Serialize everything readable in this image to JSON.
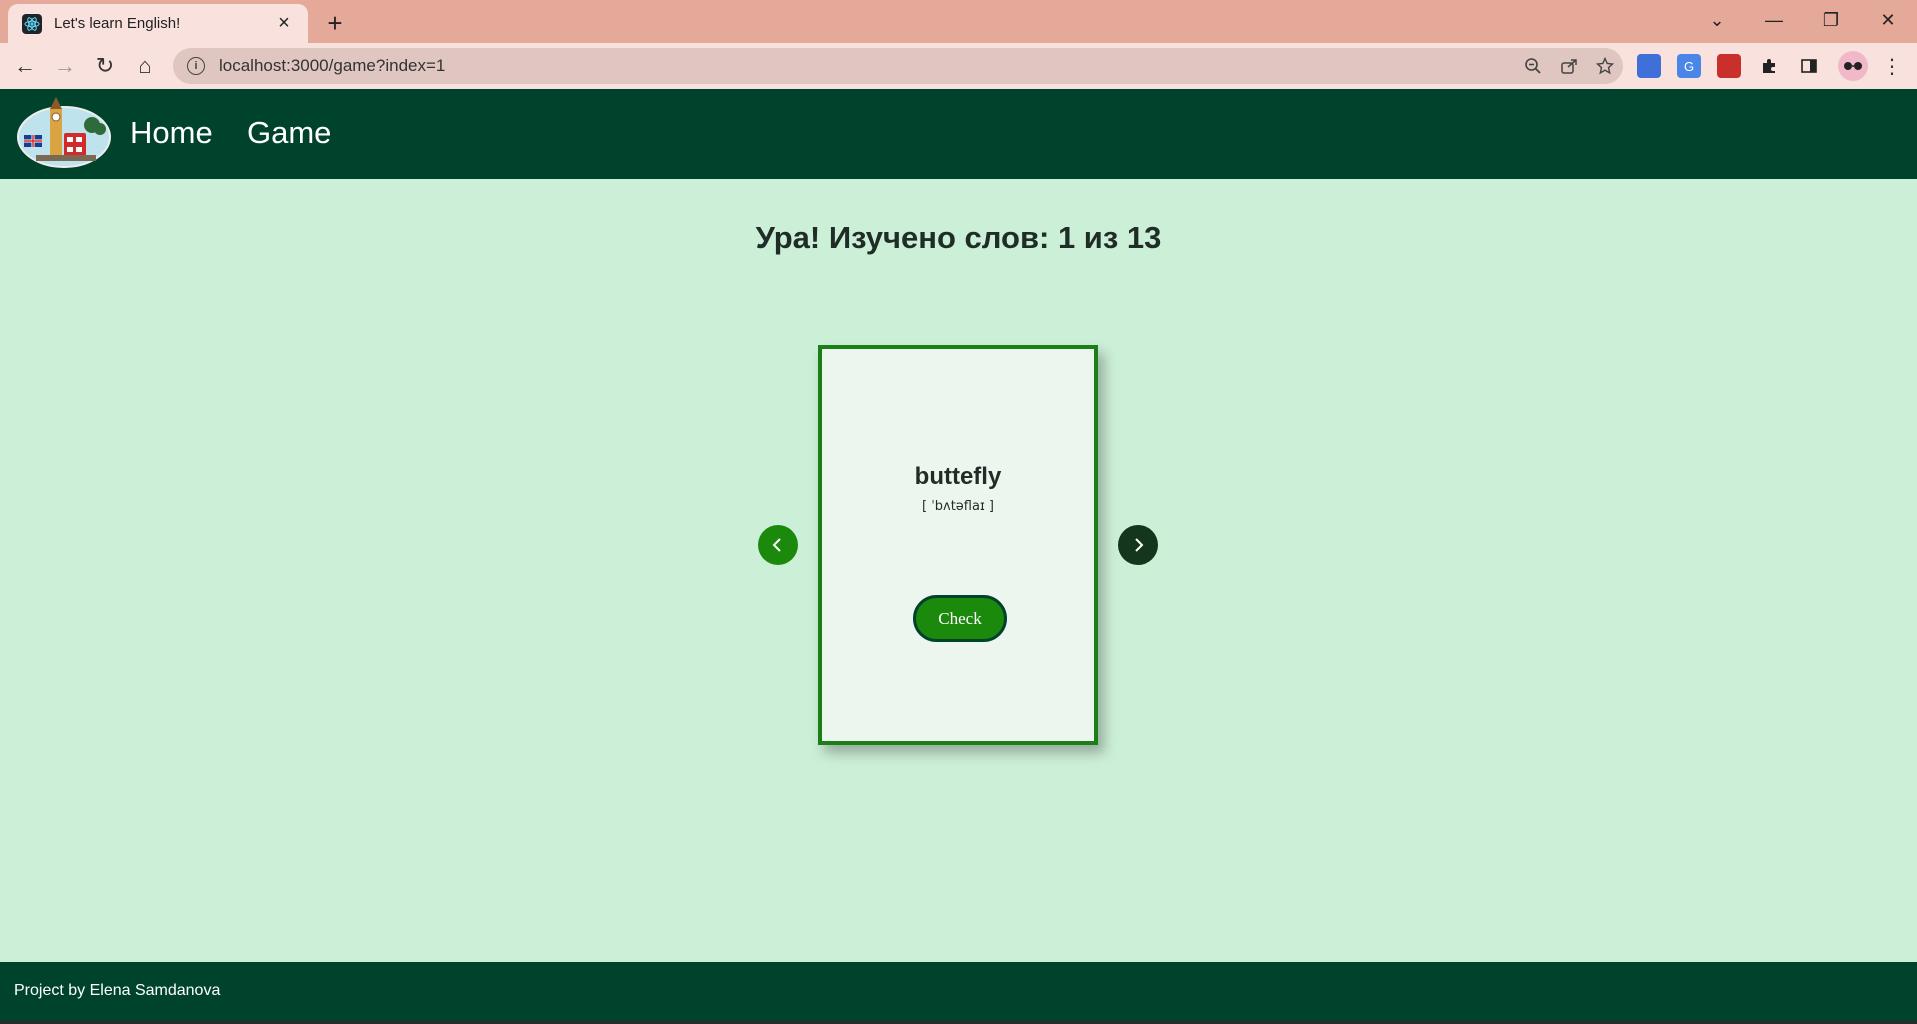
{
  "browser": {
    "tab_title": "Let's learn English!",
    "tab_close": "×",
    "new_tab": "+",
    "url": "localhost:3000/game?index=1",
    "window_controls": {
      "dropdown": "⌄",
      "minimize": "—",
      "restore": "❐",
      "close": "✕"
    },
    "nav": {
      "back": "←",
      "forward": "→",
      "reload": "↻",
      "home": "⌂"
    },
    "omnibox_icons": [
      "zoom-out-icon",
      "share-icon",
      "star-icon"
    ],
    "menu": "⋮"
  },
  "header": {
    "nav_items": [
      {
        "label": "Home"
      },
      {
        "label": "Game"
      }
    ]
  },
  "main": {
    "heading": "Ура! Изучено слов: 1 из 13",
    "prev_label": "‹",
    "next_label": "›",
    "card": {
      "word": "buttefly",
      "transcription": "[ ˈbʌtəflaɪ ]",
      "check_label": "Check"
    }
  },
  "footer": {
    "text": "Project by Elena Samdanova"
  },
  "colors": {
    "header_bg": "#00432c",
    "page_bg": "#ccefd8",
    "card_border": "#1b7e16",
    "button_green": "#1b8a0c",
    "next_button": "#13361c"
  }
}
